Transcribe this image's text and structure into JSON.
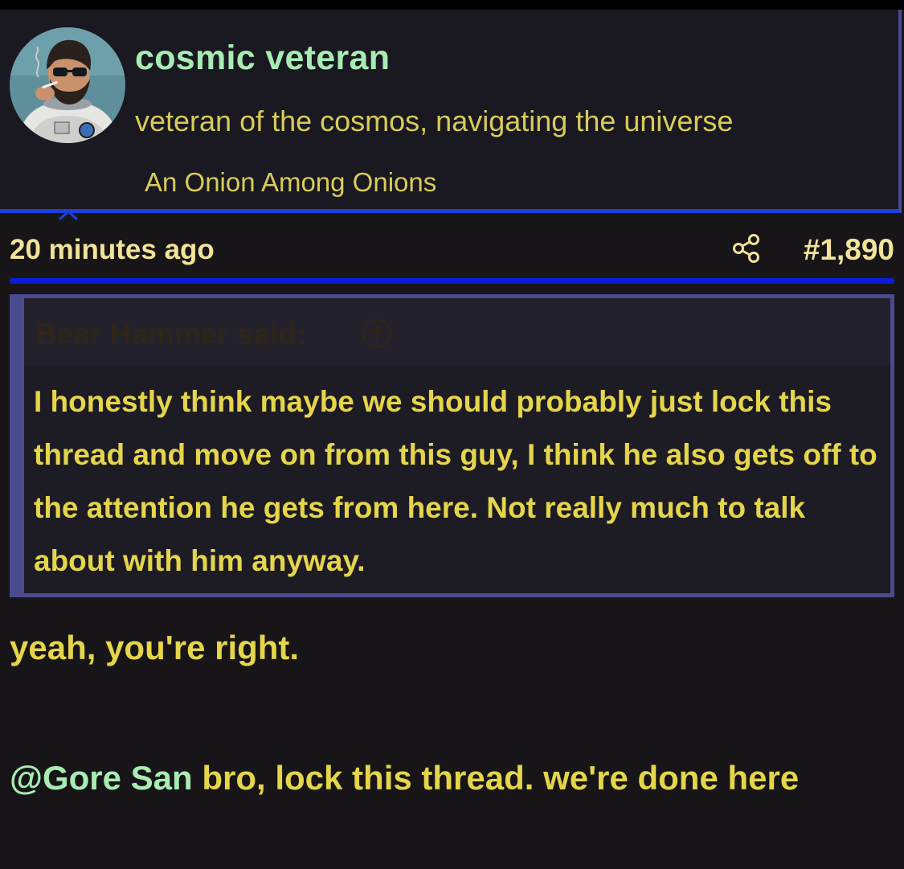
{
  "user_card": {
    "username": "cosmic veteran",
    "title": "veteran of the cosmos, navigating the universe",
    "rank": "An Onion Among Onions"
  },
  "post": {
    "timestamp": "20 minutes ago",
    "number": "#1,890",
    "quote": {
      "attribution": "Bear Hammer said:",
      "text": "I honestly think maybe we should probably just lock this thread and move on from this guy, I think he also gets off to the attention he gets from here. Not really much to talk about with him anyway."
    },
    "message": {
      "line1": "yeah, you're right.",
      "mention": "@Gore San",
      "line2_rest": " bro, lock this thread. we're done here"
    }
  },
  "colors": {
    "background": "#171517",
    "username": "#a8ecb4",
    "text_yellow": "#e5d54b",
    "quote_border": "#4c4a8e",
    "accent_blue": "#0d1cd8"
  },
  "icons": {
    "share": "share-icon",
    "quote_jump": "arrow-up-circle-icon",
    "caret": "caret-up-icon"
  }
}
